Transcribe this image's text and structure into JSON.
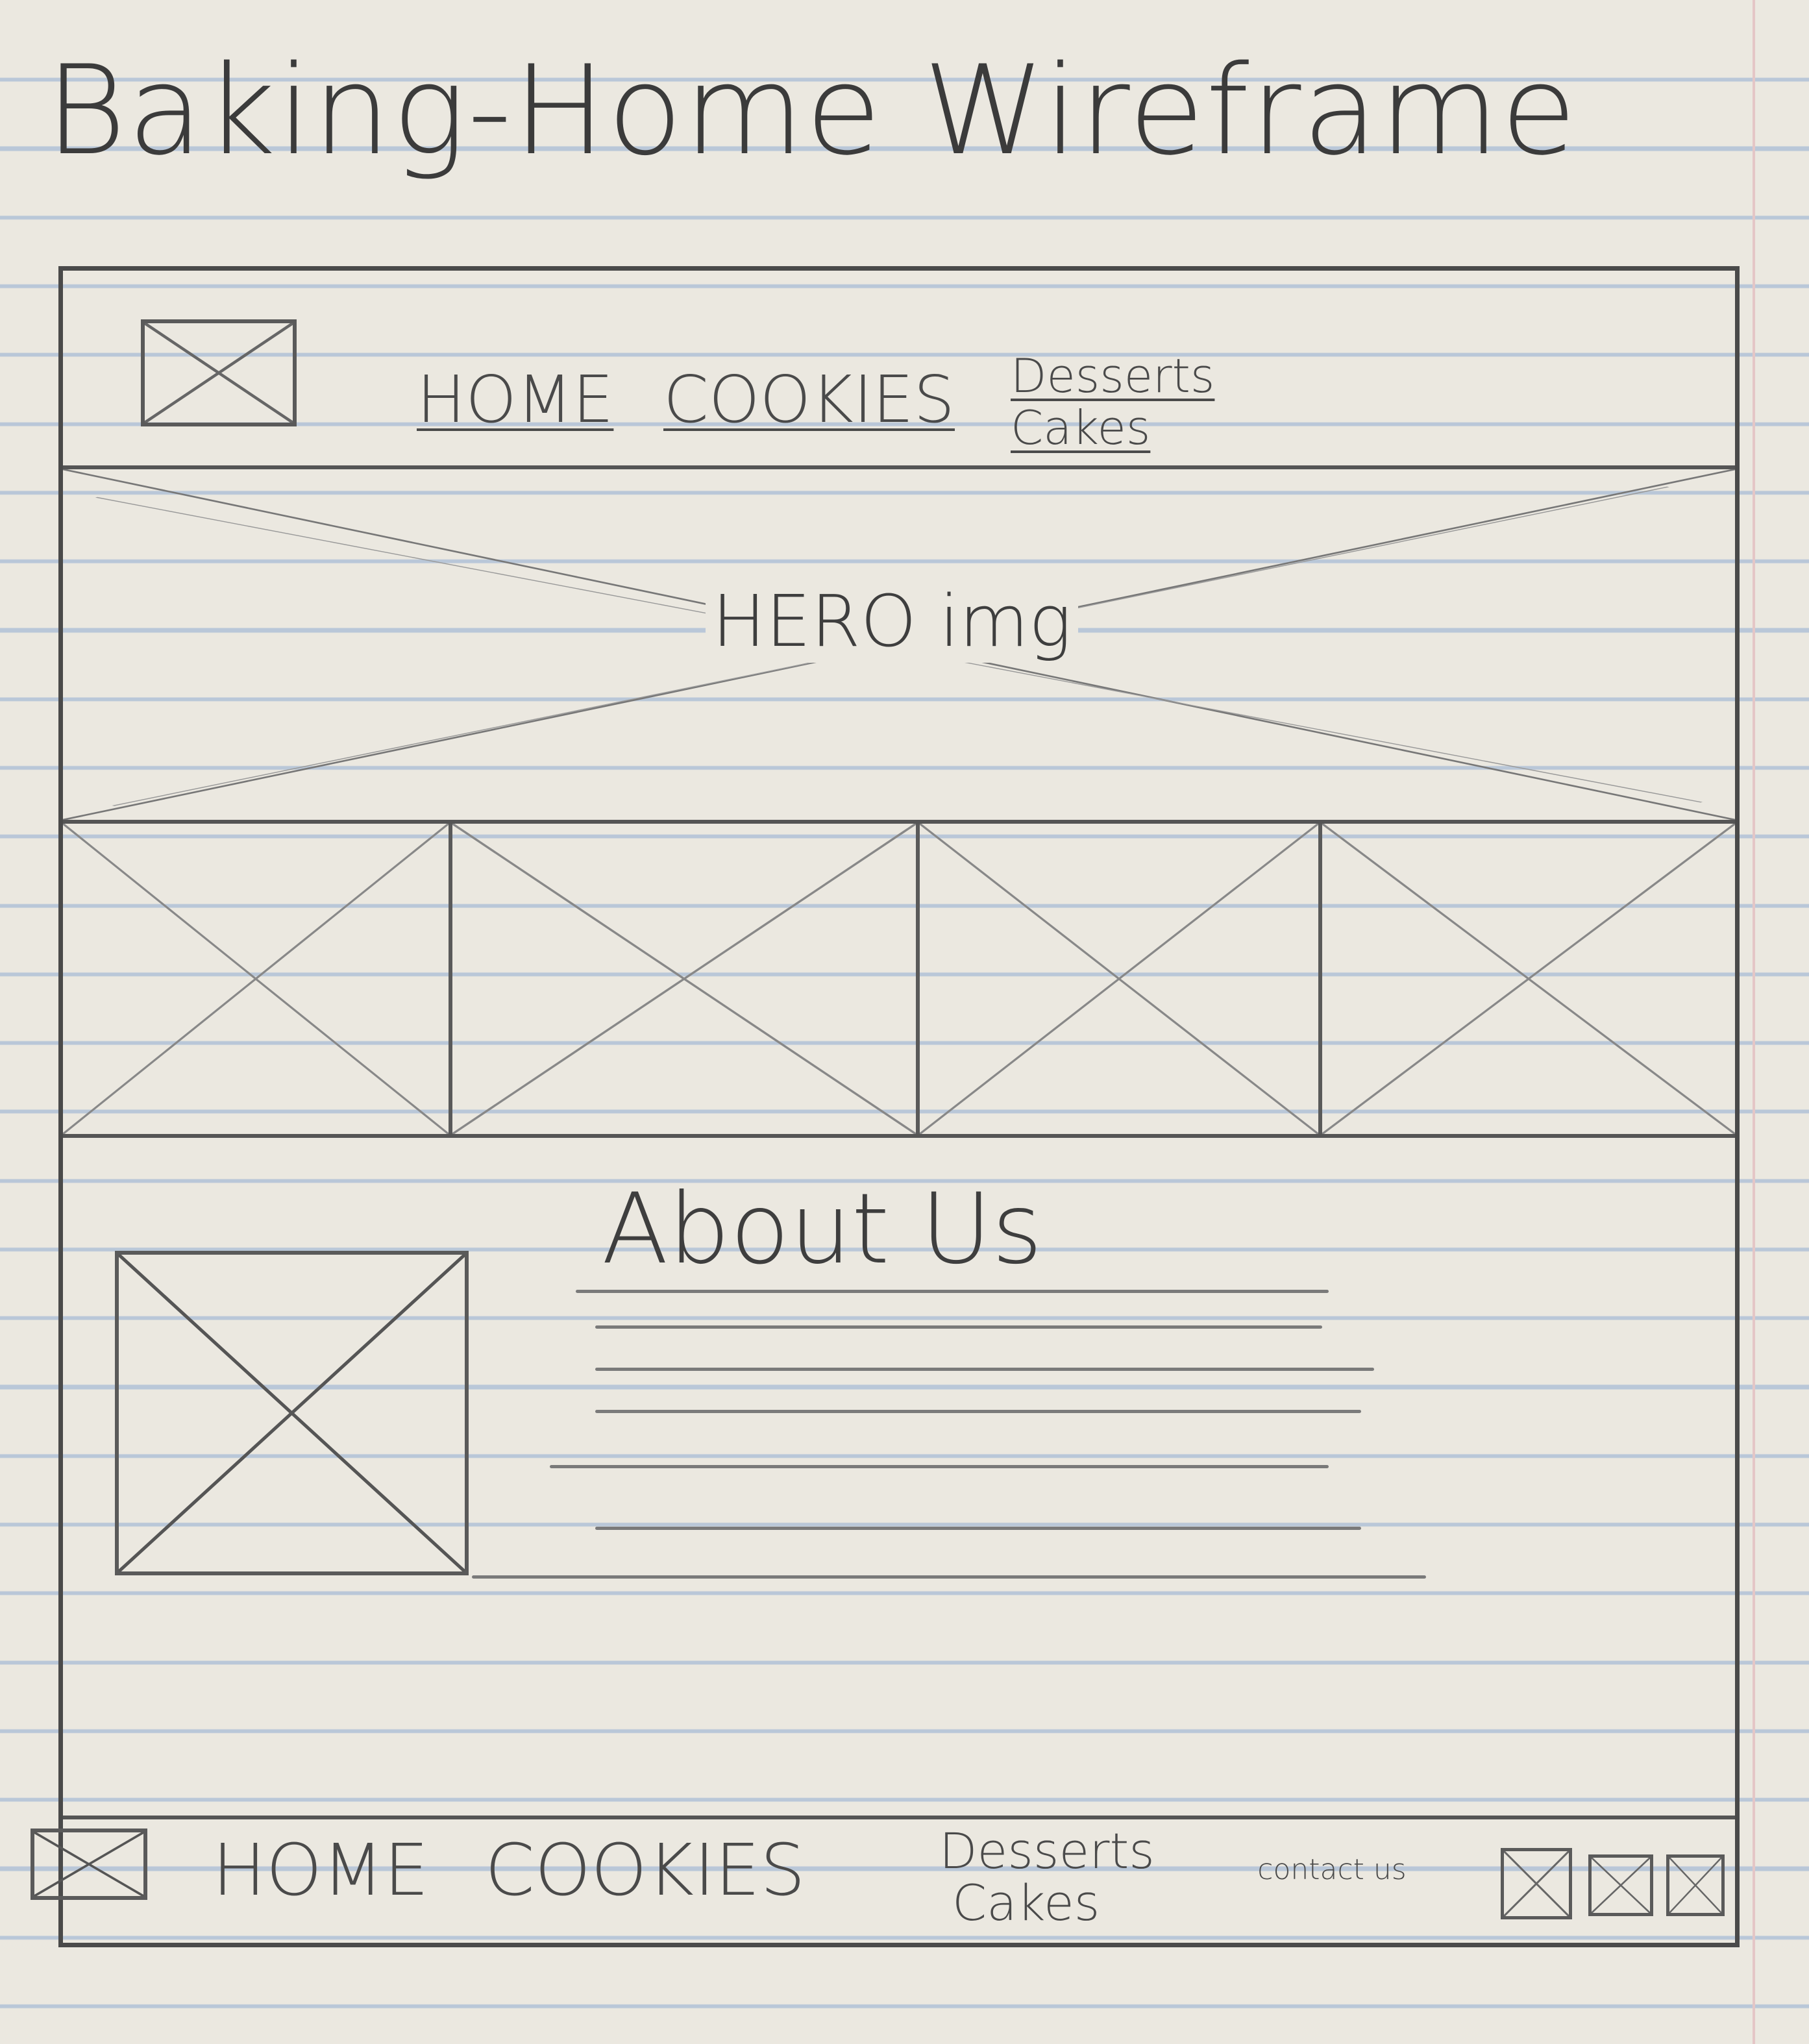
{
  "title": "Baking-Home Wireframe",
  "header": {
    "logo_icon": "image-placeholder-x",
    "nav": [
      "HOME",
      "COOKIES"
    ],
    "nav_stack": [
      "Desserts",
      "Cakes"
    ]
  },
  "hero": {
    "label": "HERO img"
  },
  "about": {
    "title": "About Us"
  },
  "footer": {
    "nav": [
      "HOME",
      "COOKIES"
    ],
    "nav_stack": [
      "Desserts",
      "Cakes"
    ],
    "contact": "contact us",
    "social_icons": [
      "image-placeholder-x",
      "image-placeholder-x",
      "image-placeholder-x"
    ]
  },
  "colors": {
    "paper": "#ebe8e0",
    "rule": "#b9c7d8",
    "pencil": "#4a4a4a"
  }
}
